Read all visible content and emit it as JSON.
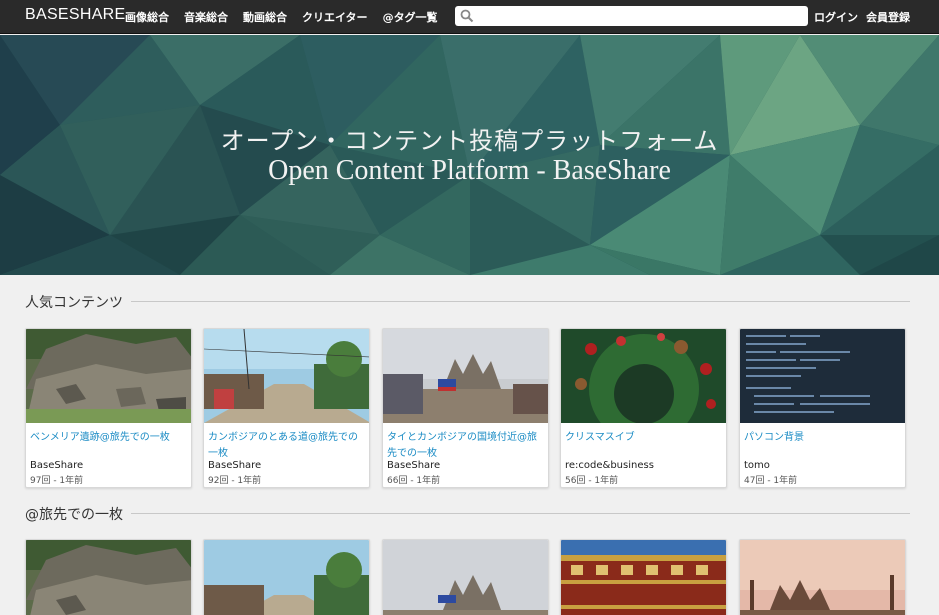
{
  "nav": {
    "brand": "BASESHARE",
    "links": [
      "画像総合",
      "音楽総合",
      "動画総合",
      "クリエイター",
      "@タグ一覧"
    ],
    "search_value": "",
    "login": "ログイン",
    "register": "会員登録"
  },
  "hero": {
    "title": "オープン・コンテント投稿プラットフォーム",
    "subtitle": "Open Content Platform - BaseShare"
  },
  "popular": {
    "heading": "人気コンテンツ",
    "cards": [
      {
        "title": "ベンメリア遺跡@旅先での一枚",
        "author": "BaseShare",
        "meta": "97回 - 1年前",
        "thumb": "ruins"
      },
      {
        "title": "カンボジアのとある道@旅先での一枚",
        "author": "BaseShare",
        "meta": "92回 - 1年前",
        "thumb": "road"
      },
      {
        "title": "タイとカンボジアの国境付近@旅先での一枚",
        "author": "BaseShare",
        "meta": "66回 - 1年前",
        "thumb": "border"
      },
      {
        "title": "クリスマスイブ",
        "author": "re:code&business",
        "meta": "56回 - 1年前",
        "thumb": "wreath"
      },
      {
        "title": "パソコン背景",
        "author": "tomo",
        "meta": "47回 - 1年前",
        "thumb": "code"
      }
    ]
  },
  "travel": {
    "heading": "@旅先での一枚",
    "cards": [
      {
        "thumb": "ruins"
      },
      {
        "thumb": "road"
      },
      {
        "thumb": "border"
      },
      {
        "thumb": "building"
      },
      {
        "thumb": "temple"
      }
    ]
  },
  "colors": {
    "navbar": "#2a2a2a",
    "link": "#1a8bc4",
    "hero": "#2a5a58"
  }
}
